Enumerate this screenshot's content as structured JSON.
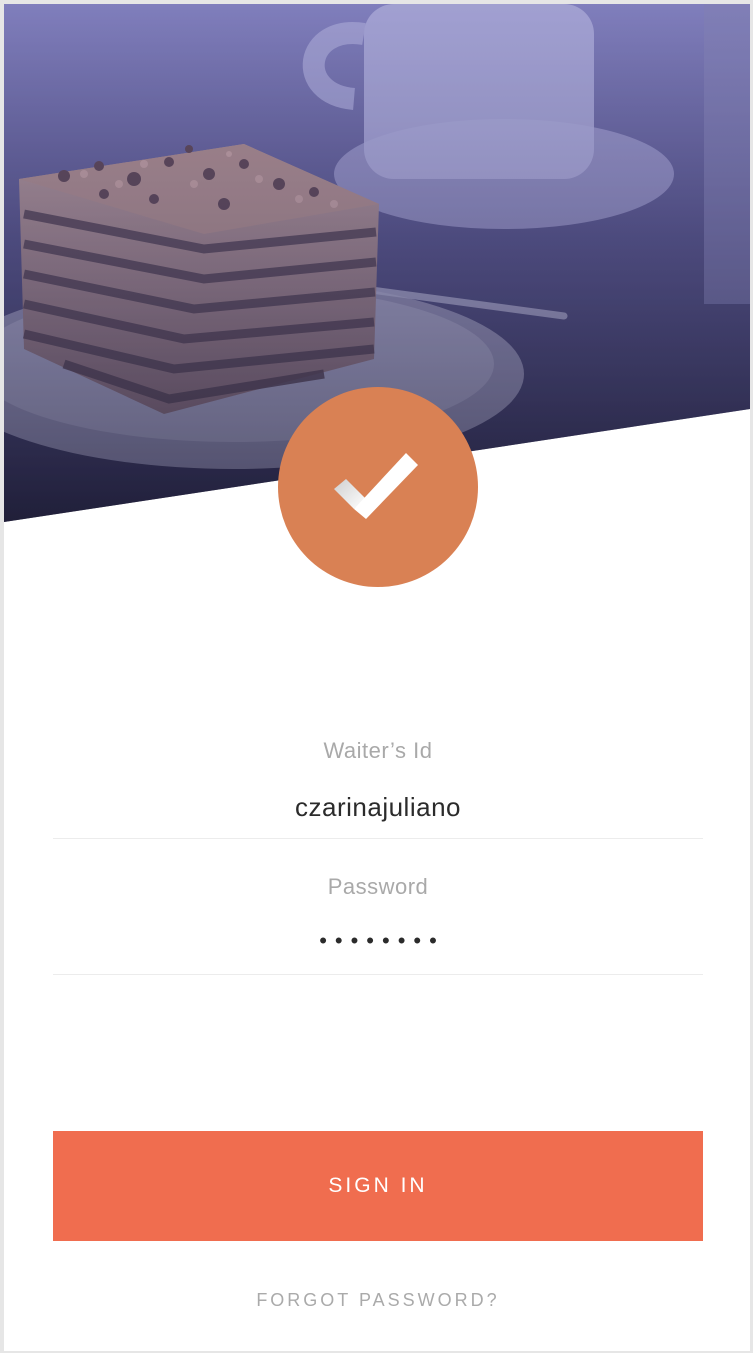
{
  "hero": {
    "image": "cake-slice-on-plate-with-coffee-cup",
    "overlay_color": "#5a5aa8"
  },
  "logo": {
    "icon": "checkmark-icon",
    "badge_color": "#d98154"
  },
  "form": {
    "waiter_id": {
      "label": "Waiter’s Id",
      "value": "czarinajuliano"
    },
    "password": {
      "label": "Password",
      "masked_value": "••••••••"
    }
  },
  "actions": {
    "sign_in_label": "SIGN IN",
    "sign_in_color": "#f06d4f",
    "forgot_password_label": "FORGOT PASSWORD?"
  }
}
